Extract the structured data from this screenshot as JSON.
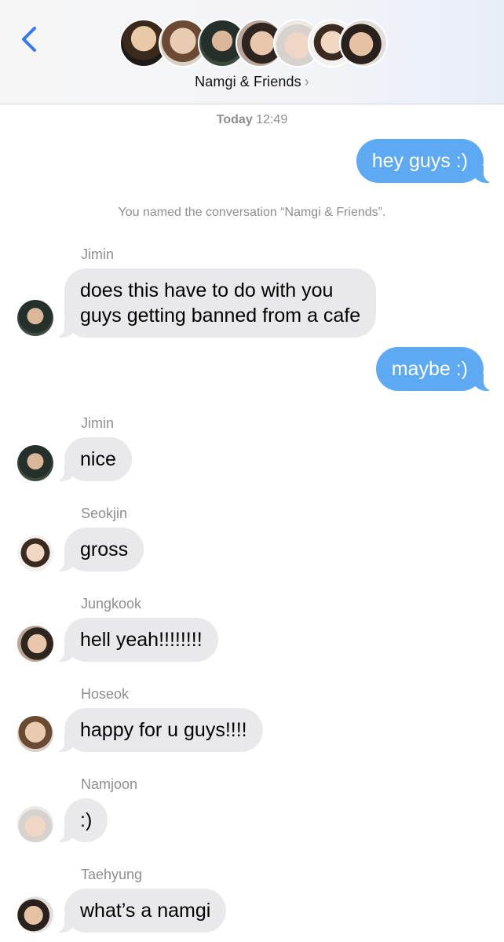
{
  "header": {
    "back_icon": "chevron-left-icon",
    "group_name": "Namgi & Friends",
    "chevron": "›",
    "accent": "#3478f6"
  },
  "timestamp": {
    "day": "Today",
    "time": "12:49"
  },
  "system_message": "You named the conversation “Namgi & Friends”.",
  "messages": [
    {
      "from": "me",
      "text": "hey guys :)"
    },
    {
      "from": "Jimin",
      "text_line1": "does this have to do with you",
      "text_line2": "guys getting banned from a cafe"
    },
    {
      "from": "me",
      "text": "maybe :)"
    },
    {
      "from": "Jimin",
      "text": "nice"
    },
    {
      "from": "Seokjin",
      "text": "gross"
    },
    {
      "from": "Jungkook",
      "text": "hell yeah!!!!!!!!"
    },
    {
      "from": "Hoseok",
      "text": "happy for u guys!!!!"
    },
    {
      "from": "Namjoon",
      "text": ":)"
    },
    {
      "from": "Taehyung",
      "text": "what’s a namgi"
    }
  ],
  "colors": {
    "outgoing": "#5eaaf2",
    "incoming": "#e9e9eb",
    "meta": "#8e8e93"
  }
}
